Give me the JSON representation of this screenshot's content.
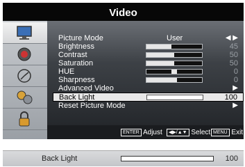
{
  "menu_title": "Video",
  "rail_icons": [
    "picture-icon",
    "sound-icon",
    "setup-icon",
    "options-icon",
    "lock-icon"
  ],
  "rows": [
    {
      "label": "Picture Mode",
      "value": "User",
      "arrows": "◀ ▶"
    },
    {
      "label": "Brightness",
      "value": "45",
      "level": 0.45
    },
    {
      "label": "Contrast",
      "value": "50",
      "level": 0.5
    },
    {
      "label": "Saturation",
      "value": "50",
      "level": 0.5
    },
    {
      "label": "HUE",
      "value": "0",
      "level": 0.5
    },
    {
      "label": "Sharpness",
      "value": "0",
      "level": 0.55
    },
    {
      "label": "Advanced Video",
      "arrow": "▶"
    },
    {
      "label": "Back Light",
      "value": "100",
      "level": 1.0
    },
    {
      "label": "Reset Picture Mode",
      "arrow": "▶"
    }
  ],
  "footer": {
    "enter_key": "ENTER",
    "adjust": "Adjust",
    "nav_key": "◀▶/▲▼",
    "select": "Select",
    "menu_key": "MENU",
    "exit": "Exit"
  },
  "strip": {
    "label": "Back Light",
    "value": "100",
    "level": 1.0
  }
}
